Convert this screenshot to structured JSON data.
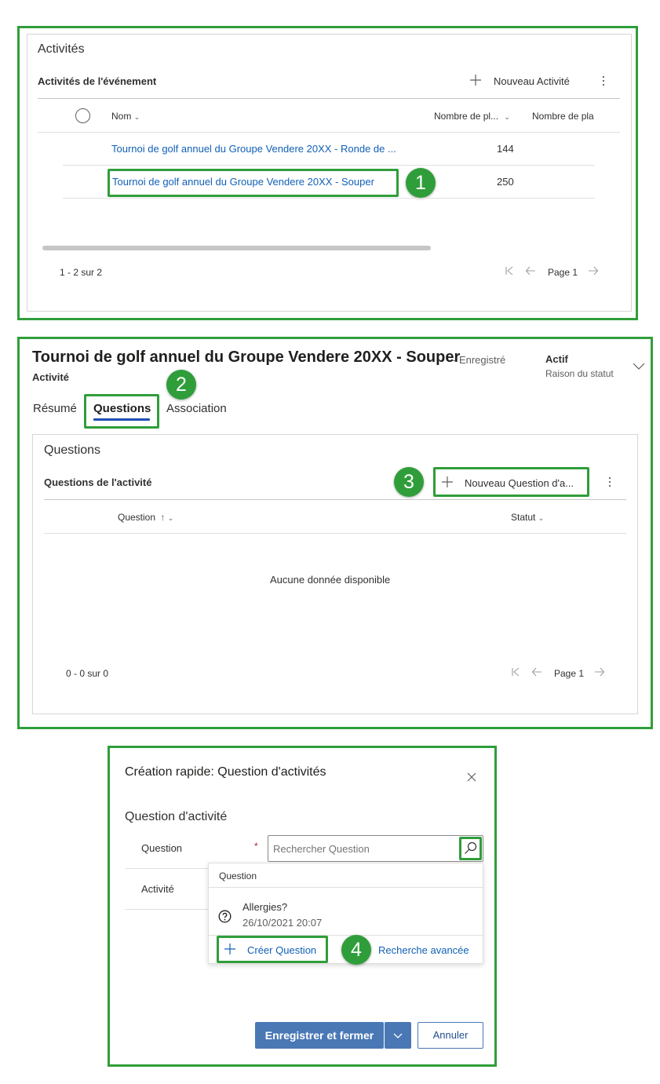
{
  "activities": {
    "section_title": "Activités",
    "subgrid_title": "Activités de l'événement",
    "new_button_label": "Nouveau Activité",
    "columns": [
      "Nom",
      "Nombre de pl...",
      "Nombre de pla"
    ],
    "rows": [
      {
        "name": "Tournoi de golf annuel du Groupe Vendere 20XX - Ronde de ...",
        "count": "144"
      },
      {
        "name": "Tournoi de golf annuel du Groupe Vendere 20XX - Souper",
        "count": "250"
      }
    ],
    "record_count": "1 - 2 sur 2",
    "page_label": "Page 1"
  },
  "record": {
    "title": "Tournoi de golf annuel du Groupe Vendere 20XX - Souper",
    "saved_status": "- Enregistré",
    "entity_type": "Activité",
    "status_value": "Actif",
    "status_label": "Raison du statut",
    "tabs": [
      "Résumé",
      "Questions",
      "Association"
    ]
  },
  "questions": {
    "section_title": "Questions",
    "subgrid_title": "Questions de l'activité",
    "new_button_label": "Nouveau Question d'a...",
    "columns": [
      "Question",
      "Statut"
    ],
    "empty_message": "Aucune donnée disponible",
    "record_count": "0 - 0 sur 0",
    "page_label": "Page 1"
  },
  "quick_create": {
    "title": "Création rapide: Question d'activités",
    "section_title": "Question d'activité",
    "question_label": "Question",
    "required_marker": "*",
    "search_placeholder": "Rechercher Question",
    "activity_label": "Activité",
    "dropdown_header": "Question",
    "result_name": "Allergies?",
    "result_date": "26/10/2021 20:07",
    "create_label": "Créer Question",
    "advanced_search_label": "Recherche avancée",
    "save_close_label": "Enregistrer et fermer",
    "cancel_label": "Annuler"
  },
  "callouts": [
    "1",
    "2",
    "3",
    "4"
  ],
  "colors": {
    "highlight": "#2f9e3a",
    "link": "#1160b7",
    "primary_button": "#4a78b5",
    "tab_underline": "#1f4fb4"
  }
}
